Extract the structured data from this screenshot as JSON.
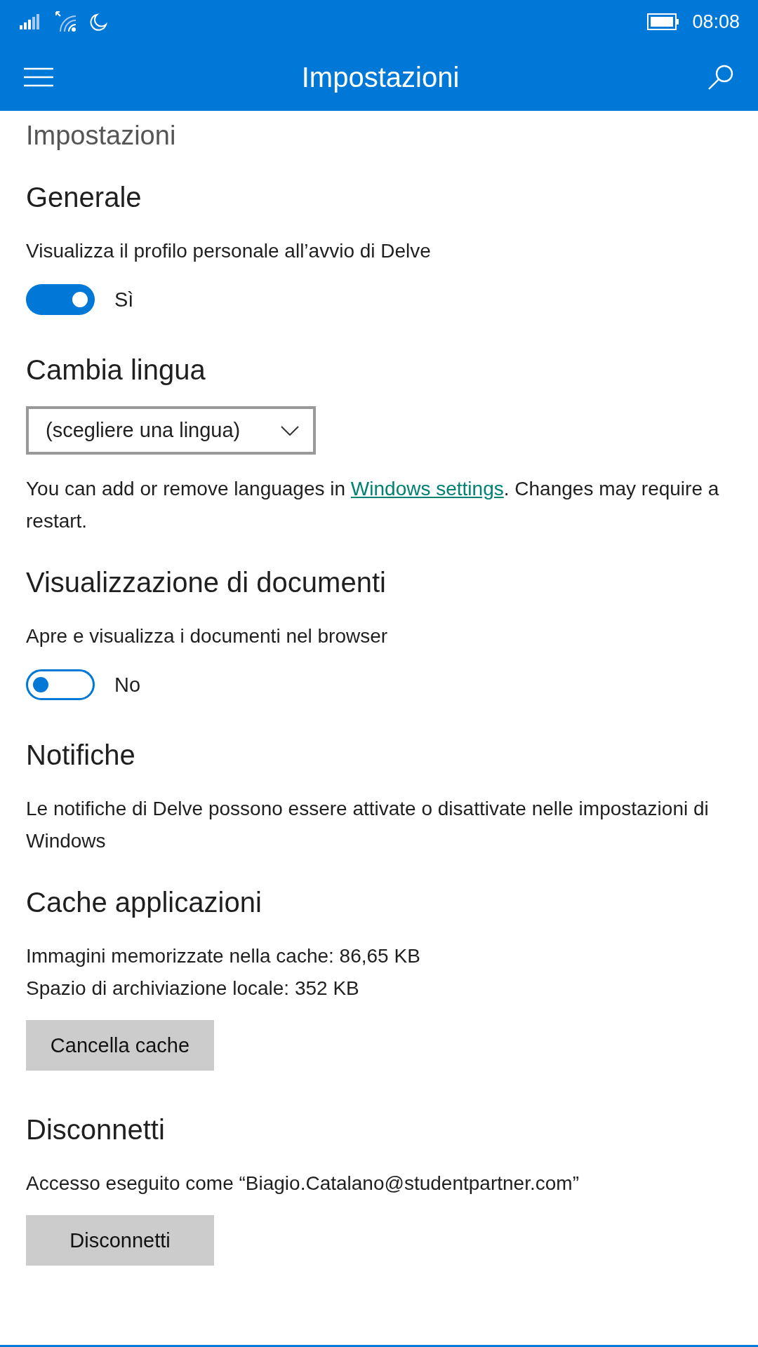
{
  "status_bar": {
    "time": "08:08"
  },
  "app_bar": {
    "title": "Impostazioni"
  },
  "page_title": "Impostazioni",
  "sections": [
    {
      "heading": "Generale",
      "items": [
        {
          "kind": "text",
          "text": "Visualizza il profilo personale all’avvio di Delve"
        },
        {
          "kind": "toggle",
          "on": true,
          "state_text": "Sì"
        }
      ]
    },
    {
      "heading": "Cambia lingua",
      "items": [
        {
          "kind": "dropdown",
          "value": "(scegliere una lingua)"
        },
        {
          "kind": "link_text",
          "before": "You can add or remove languages in ",
          "link": "Windows settings",
          "after": ". Changes may require a restart."
        }
      ]
    },
    {
      "heading": "Visualizzazione di documenti",
      "items": [
        {
          "kind": "text",
          "text": "Apre e visualizza i documenti nel browser"
        },
        {
          "kind": "toggle",
          "on": false,
          "state_text": "No"
        }
      ]
    },
    {
      "heading": "Notifiche",
      "items": [
        {
          "kind": "text",
          "text": "Le notifiche di Delve possono essere attivate o disattivate nelle impostazioni di Windows"
        }
      ]
    },
    {
      "heading": "Cache applicazioni",
      "items": [
        {
          "kind": "text",
          "text": "Immagini memorizzate nella cache: 86,65 KB"
        },
        {
          "kind": "text",
          "text": "Spazio di archiviazione locale: 352 KB"
        },
        {
          "kind": "button",
          "label": "Cancella cache"
        }
      ]
    },
    {
      "heading": "Disconnetti",
      "items": [
        {
          "kind": "text",
          "text": "Accesso eseguito come “Biagio.Catalano@studentpartner.com”"
        },
        {
          "kind": "button",
          "label": "Disconnetti"
        }
      ]
    }
  ]
}
